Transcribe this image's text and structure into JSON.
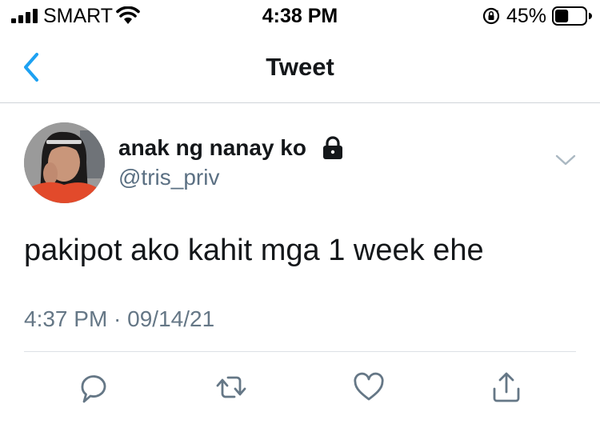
{
  "status_bar": {
    "carrier": "SMART",
    "time": "4:38 PM",
    "battery_percent": "45%",
    "battery_level": 0.45
  },
  "nav": {
    "title": "Tweet"
  },
  "tweet": {
    "display_name": "anak ng nanay ko",
    "handle": "@tris_priv",
    "text": "pakipot ako kahit mga 1 week ehe",
    "timestamp": "4:37 PM · 09/14/21"
  },
  "icons": {
    "signal": "signal-bars-icon",
    "wifi": "wifi-icon",
    "rotation_lock": "rotation-lock-icon",
    "battery": "battery-icon",
    "back": "chevron-left-icon",
    "protected": "lock-icon",
    "more": "chevron-down-icon",
    "reply": "reply-icon",
    "retweet": "retweet-icon",
    "like": "heart-icon",
    "share": "share-icon"
  },
  "colors": {
    "accent": "#1da1f2",
    "text_primary": "#14171a",
    "text_secondary": "#657786",
    "icon_gray": "#657786"
  }
}
